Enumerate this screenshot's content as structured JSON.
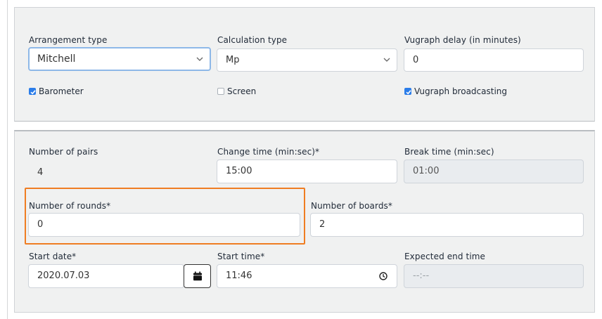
{
  "settings": {
    "arrangement_type": {
      "label": "Arrangement type",
      "value": "Mitchell"
    },
    "calculation_type": {
      "label": "Calculation type",
      "value": "Mp"
    },
    "vugraph_delay": {
      "label": "Vugraph delay (in minutes)",
      "value": "0"
    },
    "barometer": {
      "label": "Barometer",
      "checked": true
    },
    "screen": {
      "label": "Screen",
      "checked": false
    },
    "vugraph_broadcasting": {
      "label": "Vugraph broadcasting",
      "checked": true
    }
  },
  "schedule": {
    "number_of_pairs": {
      "label": "Number of pairs",
      "value": "4"
    },
    "change_time": {
      "label": "Change time (min:sec)*",
      "value": "15:00"
    },
    "break_time": {
      "label": "Break time (min:sec)",
      "value": "01:00"
    },
    "number_of_rounds": {
      "label": "Number of rounds*",
      "value": "0"
    },
    "number_of_boards": {
      "label": "Number of boards*",
      "value": "2"
    },
    "start_date": {
      "label": "Start date*",
      "value": "2020.07.03"
    },
    "start_time": {
      "label": "Start time*",
      "value": "11:46"
    },
    "expected_end_time": {
      "label": "Expected end time",
      "value": "--:--"
    }
  },
  "icons": {
    "select_chevron": "chevron-down-icon",
    "calendar": "calendar-icon",
    "clock": "clock-icon",
    "checkmark": "checkmark-icon"
  },
  "colors": {
    "highlight": "#ef7d22",
    "checkbox_checked": "#2b7de9",
    "focus_ring": "#8eb8e8",
    "panel_bg": "#f0f1f1"
  }
}
